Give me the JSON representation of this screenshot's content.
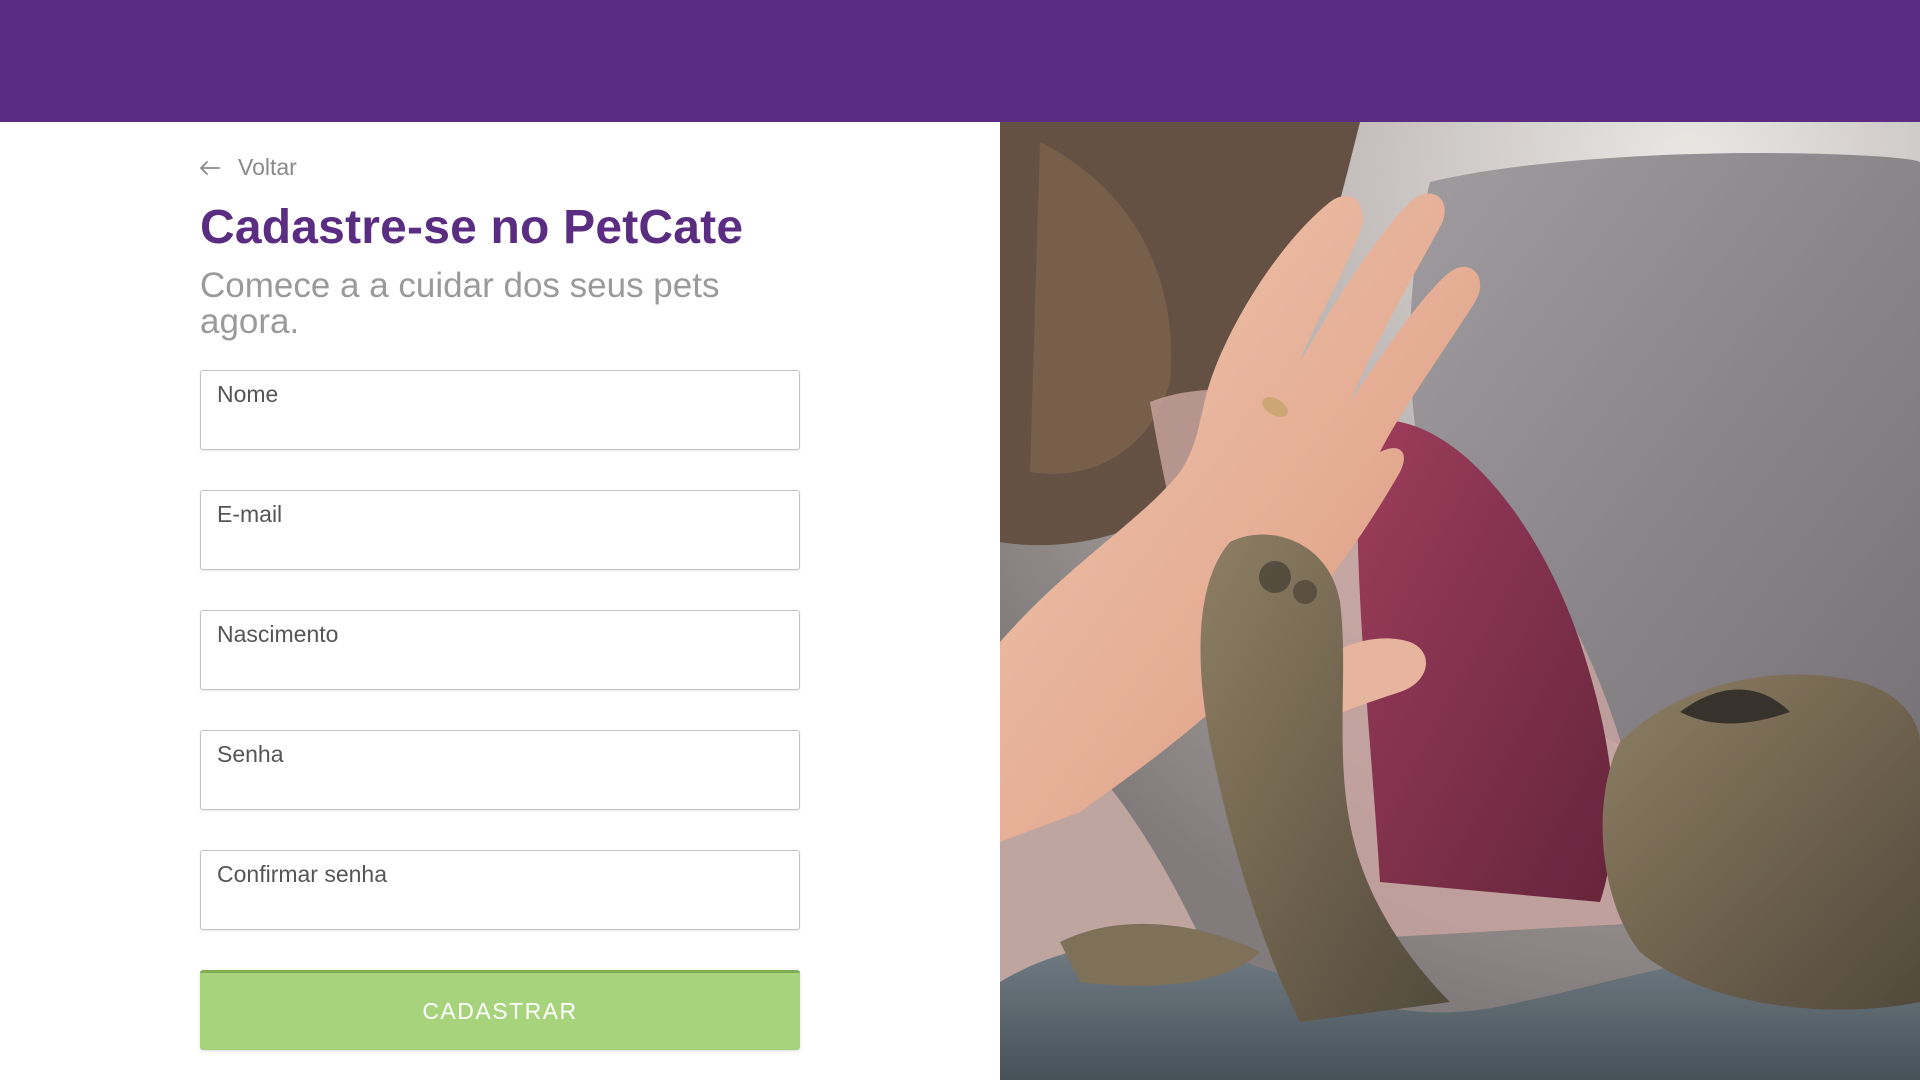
{
  "back_link": {
    "label": "Voltar",
    "icon": "arrow-left-icon"
  },
  "heading": {
    "title": "Cadastre-se no PetCate",
    "subtitle": "Comece a a cuidar dos seus pets agora."
  },
  "form": {
    "fields": [
      {
        "label": "Nome",
        "value": ""
      },
      {
        "label": "E-mail",
        "value": ""
      },
      {
        "label": "Nascimento",
        "value": ""
      },
      {
        "label": "Senha",
        "value": ""
      },
      {
        "label": "Confirmar senha",
        "value": ""
      }
    ],
    "submit_label": "CADASTRAR"
  },
  "colors": {
    "brand_purple": "#5a2d82",
    "button_green": "#a6d37c",
    "muted_text": "#9a9a9a"
  }
}
